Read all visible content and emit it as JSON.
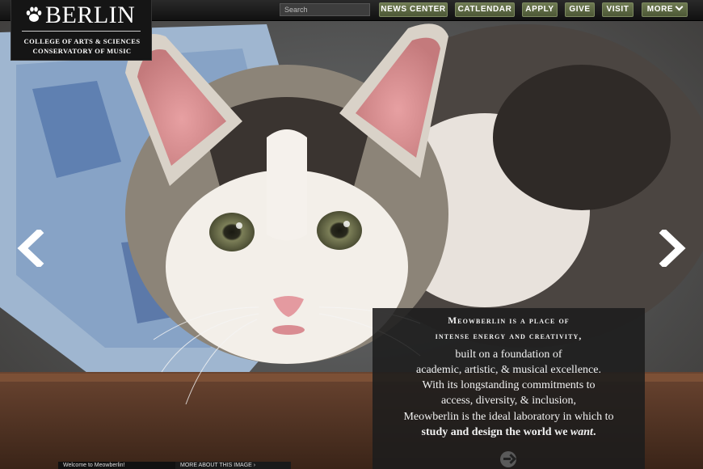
{
  "header": {
    "search_placeholder": "Search",
    "nav": [
      {
        "label": "NEWS CENTER"
      },
      {
        "label": "CATLENDAR"
      },
      {
        "label": "APPLY"
      },
      {
        "label": "GIVE"
      },
      {
        "label": "VISIT"
      },
      {
        "label": "MORE"
      }
    ]
  },
  "logo": {
    "name": "BERLIN",
    "line1": "COLLEGE OF ARTS & SCIENCES",
    "line2": "CONSERVATORY OF MUSIC",
    "icon": "paw-icon"
  },
  "carousel": {
    "prev_icon": "chevron-left-icon",
    "next_icon": "chevron-right-icon"
  },
  "caption": {
    "heading1": "Meowberlin is a place of",
    "heading2": "intense energy and creativity,",
    "lines": [
      "built on a foundation of",
      "academic, artistic, & musical excellence.",
      "With its longstanding commitments to",
      "access, diversity, & inclusion,",
      "Meowberlin is the ideal laboratory in which to"
    ],
    "last_line_prefix": "study and design the world we ",
    "last_line_em": "want",
    "last_line_suffix": ".",
    "more_icon": "arrow-right-circle-icon"
  },
  "footer": {
    "welcome": "Welcome to Meowberlin!",
    "more_about": "MORE ABOUT THIS IMAGE ›"
  },
  "colors": {
    "nav_button": "#5c6843",
    "caption_bg": "#1c1c1c",
    "logo_bg": "#151515"
  }
}
